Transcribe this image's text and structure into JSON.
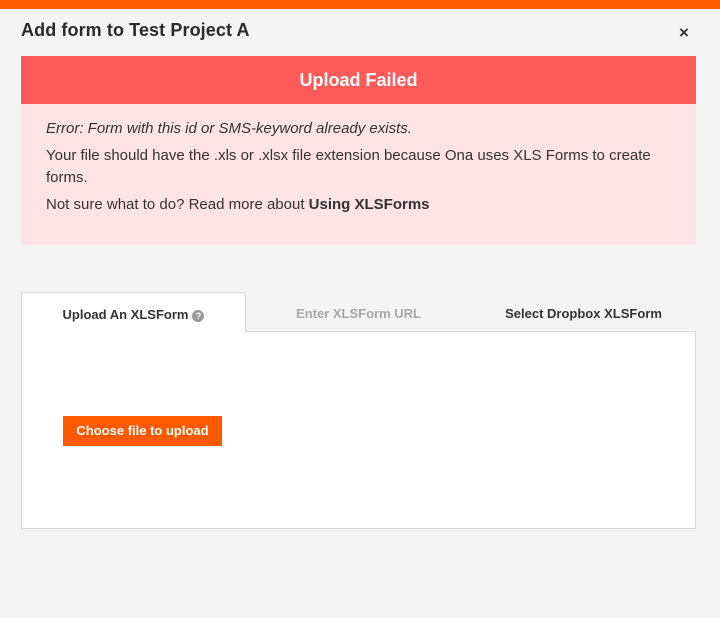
{
  "modal": {
    "title": "Add form to Test Project A",
    "close_label": "×"
  },
  "alert": {
    "heading": "Upload Failed",
    "error_text": "Error: Form with this id or SMS-keyword already exists.",
    "info_text": "Your file should have the .xls or .xlsx file extension because Ona uses XLS Forms to create forms.",
    "help_prefix": "Not sure what to do? Read more about ",
    "help_link": "Using XLSForms"
  },
  "tabs": [
    {
      "label": "Upload An XLSForm",
      "active": true
    },
    {
      "label": "Enter XLSForm URL",
      "active": false
    },
    {
      "label": "Select Dropbox XLSForm",
      "active": false
    }
  ],
  "help_icon_glyph": "?",
  "upload": {
    "button_label": "Choose file to upload"
  },
  "colors": {
    "brand": "#ff5a00",
    "alert_header": "#ff5a5a",
    "alert_body": "#ffe3e6"
  }
}
